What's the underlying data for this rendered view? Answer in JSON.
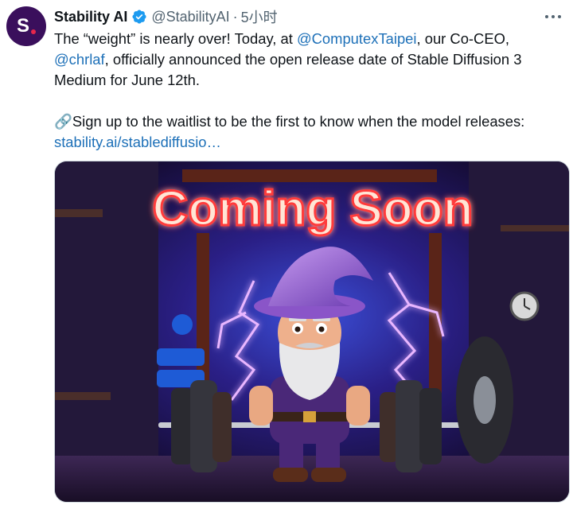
{
  "tweet": {
    "avatar_letter": "S",
    "display_name": "Stability AI",
    "handle": "@StabilityAI",
    "separator": "·",
    "time": "5小时",
    "body": {
      "line1_a": "The “weight” is nearly over! Today, at ",
      "mention1": "@ComputexTaipei",
      "line1_b": ", our Co-CEO,",
      "mention2": "@chrlaf",
      "line2_b": ", officially announced the open release date of Stable Diffusion 3 Medium for June 12th.",
      "para2_emoji": "🔗",
      "para2_text": "Sign up to the waitlist to be the first to know when the model releases:",
      "link": "stability.ai/stablediffusio…"
    },
    "media": {
      "headline": "Coming Soon",
      "description_icon": "wizard-weightlifter-image"
    }
  },
  "colors": {
    "avatar_bg": "#3a0f5c",
    "avatar_dot": "#e8274b",
    "link": "#1d70b8",
    "verified": "#1d9bf0",
    "muted": "#536471"
  }
}
